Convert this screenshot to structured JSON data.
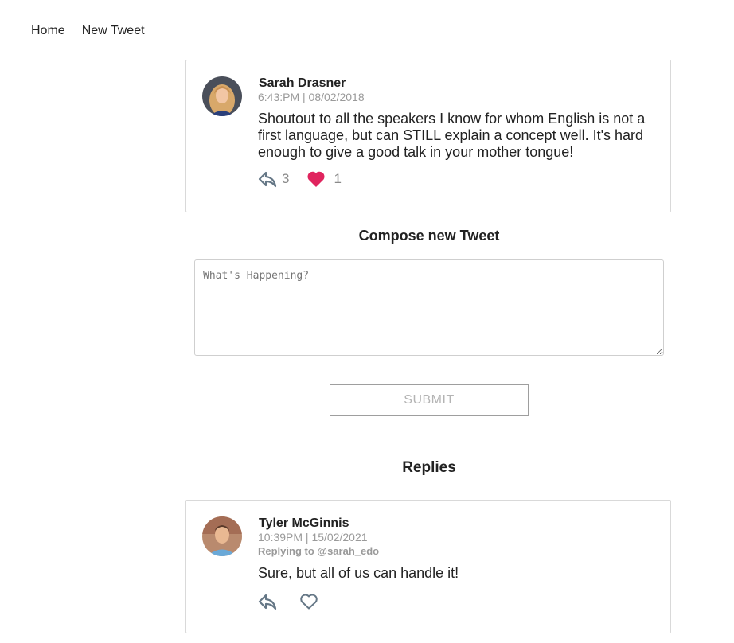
{
  "nav": {
    "home": "Home",
    "new_tweet": "New Tweet"
  },
  "tweet": {
    "author": "Sarah Drasner",
    "meta": "6:43:PM | 08/02/2018",
    "text": "Shoutout to all the speakers I know for whom English is not a first language, but can STILL explain a concept well. It's hard enough to give a good talk in your mother tongue!",
    "reply_count": "3",
    "like_count": "1",
    "liked": true
  },
  "compose": {
    "title": "Compose new Tweet",
    "placeholder": "What's Happening?",
    "submit_label": "SUBMIT"
  },
  "replies": {
    "title": "Replies",
    "items": [
      {
        "author": "Tyler McGinnis",
        "meta": "10:39PM | 15/02/2021",
        "replying_to": "Replying to @sarah_edo",
        "text": "Sure, but all of us can handle it!",
        "liked": false
      }
    ]
  },
  "colors": {
    "like_active": "#e0245e",
    "icon_gray": "#657786",
    "meta_gray": "#9a9a9a"
  },
  "icons": {
    "reply": "reply-arrow-icon",
    "like": "heart-icon"
  }
}
